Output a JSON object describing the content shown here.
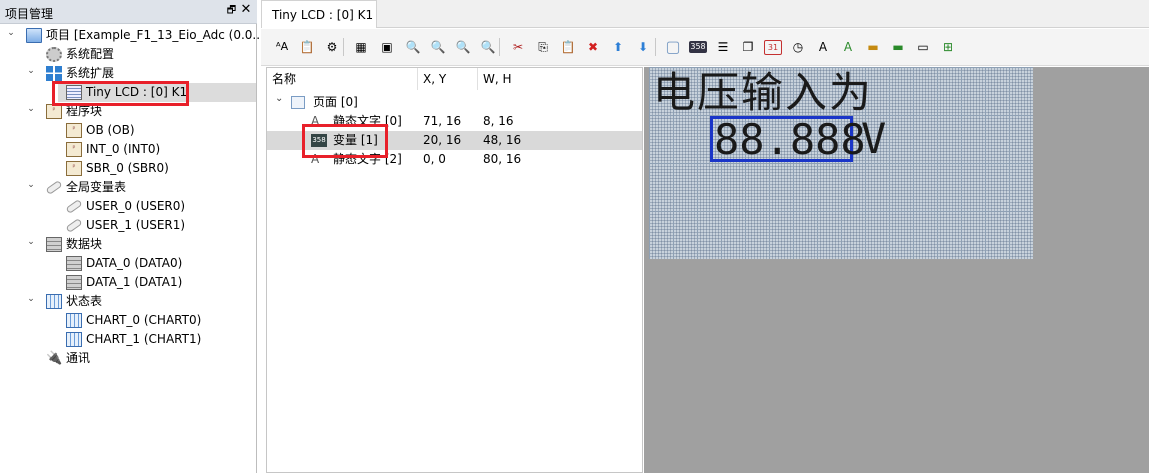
{
  "left_panel": {
    "title": "项目管理",
    "float_glyph": "🗗",
    "close_glyph": "✕",
    "tree": [
      {
        "label": "项目 [Example_F1_13_Eio_Adc (0.0...",
        "icon": "computer-icon",
        "expanded": true
      },
      {
        "label": "系统配置",
        "icon": "gear-icon"
      },
      {
        "label": "系统扩展",
        "icon": "grid-icon",
        "expanded": true
      },
      {
        "label": "Tiny LCD : [0] K1",
        "icon": "lcd-icon",
        "selected": true
      },
      {
        "label": "程序块",
        "icon": "program-icon",
        "expanded": true
      },
      {
        "label": "OB (OB)",
        "icon": "program-icon"
      },
      {
        "label": "INT_0 (INT0)",
        "icon": "program-icon"
      },
      {
        "label": "SBR_0 (SBR0)",
        "icon": "program-icon"
      },
      {
        "label": "全局变量表",
        "icon": "tag-icon",
        "expanded": true
      },
      {
        "label": "USER_0 (USER0)",
        "icon": "tag-icon"
      },
      {
        "label": "USER_1 (USER1)",
        "icon": "tag-icon"
      },
      {
        "label": "数据块",
        "icon": "database-icon",
        "expanded": true
      },
      {
        "label": "DATA_0 (DATA0)",
        "icon": "database-icon"
      },
      {
        "label": "DATA_1 (DATA1)",
        "icon": "database-icon"
      },
      {
        "label": "状态表",
        "icon": "chart-table-icon",
        "expanded": true
      },
      {
        "label": "CHART_0 (CHART0)",
        "icon": "chart-table-icon"
      },
      {
        "label": "CHART_1 (CHART1)",
        "icon": "chart-table-icon"
      },
      {
        "label": "通讯",
        "icon": "plug-icon"
      }
    ]
  },
  "editor": {
    "tab_label": "Tiny LCD : [0] K1",
    "toolbar": [
      {
        "name": "font-size-icon",
        "glyph": "ᴬA"
      },
      {
        "name": "paste-format-icon",
        "glyph": "📋"
      },
      {
        "name": "settings-icon",
        "glyph": "⚙"
      },
      {
        "name": "grid-toggle-icon",
        "glyph": "▦"
      },
      {
        "name": "snap-grid-icon",
        "glyph": "▣"
      },
      {
        "name": "zoom-in-icon",
        "glyph": "🔍"
      },
      {
        "name": "zoom-out-icon",
        "glyph": "🔍"
      },
      {
        "name": "zoom-fit-icon",
        "glyph": "🔍"
      },
      {
        "name": "zoom-reset-icon",
        "glyph": "🔍"
      },
      {
        "name": "cut-icon",
        "glyph": "✂"
      },
      {
        "name": "copy-icon",
        "glyph": "⎘"
      },
      {
        "name": "paste-icon",
        "glyph": "📋"
      },
      {
        "name": "delete-icon",
        "glyph": "✖"
      },
      {
        "name": "move-up-icon",
        "glyph": "⬆"
      },
      {
        "name": "move-down-icon",
        "glyph": "⬇"
      },
      {
        "name": "page-icon",
        "glyph": "▢"
      },
      {
        "name": "variable-icon",
        "glyph": "358"
      },
      {
        "name": "align-icon",
        "glyph": "☰"
      },
      {
        "name": "layers-icon",
        "glyph": "❐"
      },
      {
        "name": "calendar-icon",
        "glyph": "31"
      },
      {
        "name": "clock-icon",
        "glyph": "◷"
      },
      {
        "name": "static-text-icon",
        "glyph": "A"
      },
      {
        "name": "dynamic-text-icon",
        "glyph": "A"
      },
      {
        "name": "image-icon",
        "glyph": "▬"
      },
      {
        "name": "image-list-icon",
        "glyph": "▬"
      },
      {
        "name": "bar-icon",
        "glyph": "▭"
      },
      {
        "name": "tree-icon",
        "glyph": "⊞"
      }
    ],
    "list": {
      "columns": [
        "名称",
        "X, Y",
        "W, H"
      ],
      "rows": [
        {
          "name": "页面 [0]",
          "xy": "",
          "wh": "",
          "icon": "page-icon",
          "indent": 0,
          "expanded": true
        },
        {
          "name": "静态文字 [0]",
          "xy": "71, 16",
          "wh": "8, 16",
          "icon": "static-text-icon",
          "indent": 1
        },
        {
          "name": "变量 [1]",
          "xy": "20, 16",
          "wh": "48, 16",
          "icon": "variable-icon",
          "indent": 1,
          "selected": true
        },
        {
          "name": "静态文字 [2]",
          "xy": "0, 0",
          "wh": "80, 16",
          "icon": "static-text-icon",
          "indent": 1
        }
      ]
    },
    "lcd": {
      "static_text": "电压输入为",
      "variable_text": "88.888",
      "unit_text": "V"
    }
  }
}
